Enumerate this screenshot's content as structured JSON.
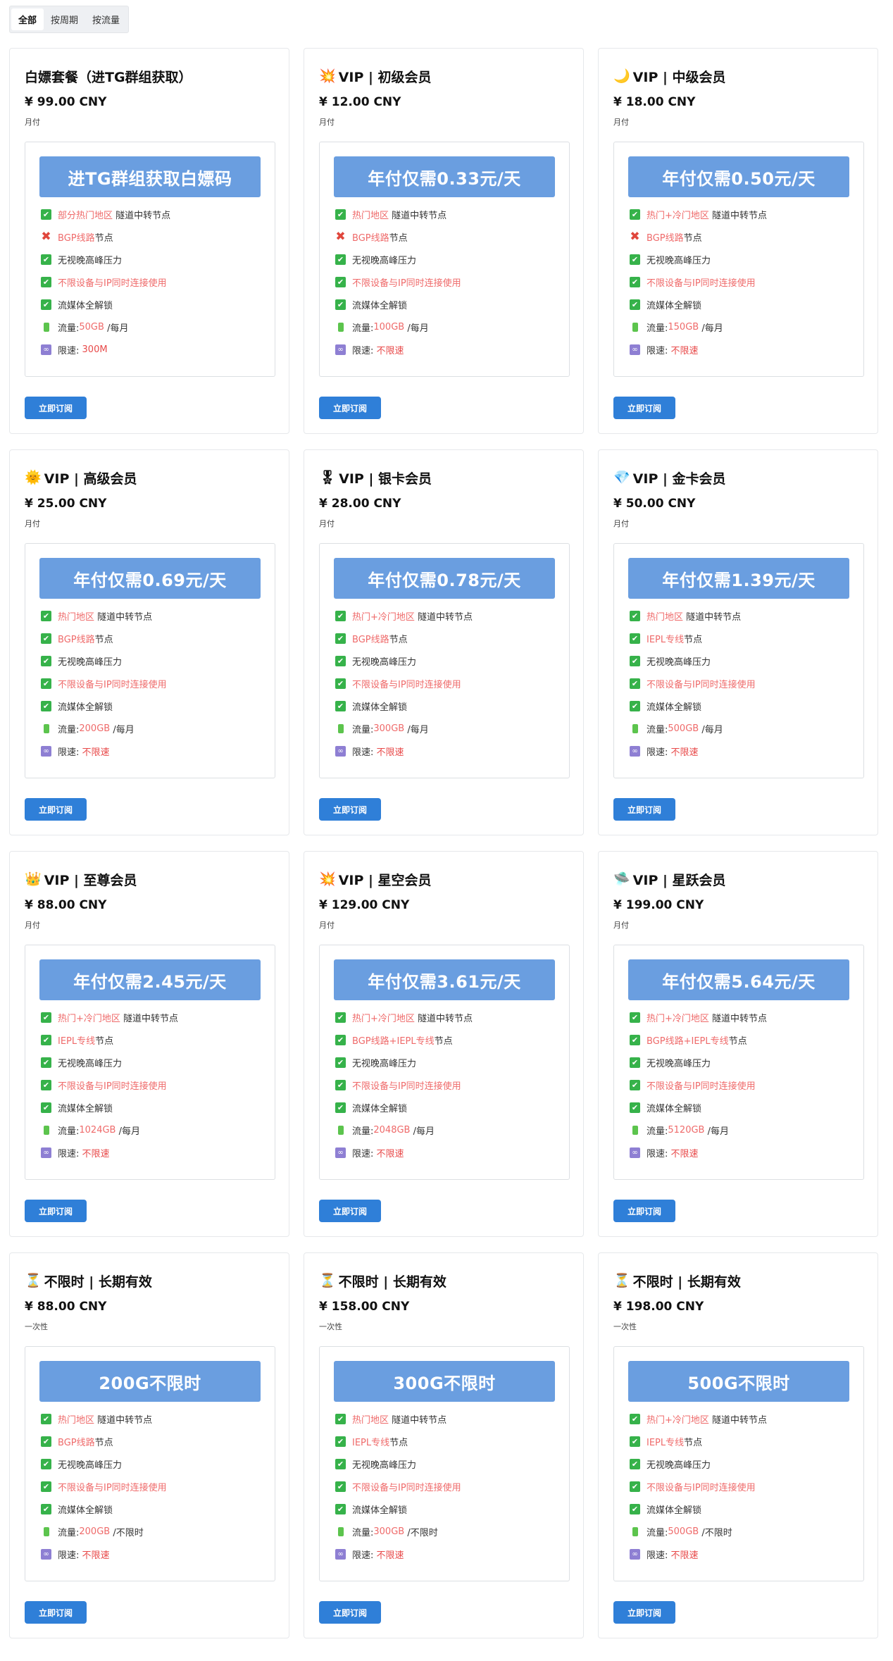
{
  "tabs": [
    {
      "label": "全部",
      "active": true
    },
    {
      "label": "按周期",
      "active": false
    },
    {
      "label": "按流量",
      "active": false
    }
  ],
  "features_common": {
    "node_suffix": "隧道中转节点",
    "node_line_suffix": "节点",
    "peak": "无视晚高峰压力",
    "devices": "不限设备与IP同时连接使用",
    "media": "流媒体全解锁",
    "traffic_label": "流量:",
    "speed_label": "限速:",
    "buy": "立即订阅"
  },
  "plans": [
    {
      "icon": "",
      "title": "白嫖套餐（进TG群组获取）",
      "price": "¥ 99.00 CNY",
      "period": "月付",
      "banner": "进TG群组获取白嫖码",
      "region": "部分热门地区",
      "line": "BGP线路",
      "line_ok": false,
      "traffic": "50GB",
      "traffic_suffix": "/每月",
      "speed": "300M"
    },
    {
      "icon": "💥",
      "title": "VIP | 初级会员",
      "price": "¥ 12.00 CNY",
      "period": "月付",
      "banner": "年付仅需0.33元/天",
      "region": "热门地区",
      "line": "BGP线路",
      "line_ok": false,
      "traffic": "100GB",
      "traffic_suffix": "/每月",
      "speed": "不限速"
    },
    {
      "icon": "🌙",
      "title": "VIP | 中级会员",
      "price": "¥ 18.00 CNY",
      "period": "月付",
      "banner": "年付仅需0.50元/天",
      "region": "热门+冷门地区",
      "line": "BGP线路",
      "line_ok": false,
      "traffic": "150GB",
      "traffic_suffix": "/每月",
      "speed": "不限速"
    },
    {
      "icon": "🌞",
      "title": "VIP | 高级会员",
      "price": "¥ 25.00 CNY",
      "period": "月付",
      "banner": "年付仅需0.69元/天",
      "region": "热门地区",
      "line": "BGP线路",
      "line_ok": true,
      "traffic": "200GB",
      "traffic_suffix": "/每月",
      "speed": "不限速"
    },
    {
      "icon": "🎖",
      "title": "VIP | 银卡会员",
      "price": "¥ 28.00 CNY",
      "period": "月付",
      "banner": "年付仅需0.78元/天",
      "region": "热门+冷门地区",
      "line": "BGP线路",
      "line_ok": true,
      "traffic": "300GB",
      "traffic_suffix": "/每月",
      "speed": "不限速"
    },
    {
      "icon": "💎",
      "title": "VIP | 金卡会员",
      "price": "¥ 50.00 CNY",
      "period": "月付",
      "banner": "年付仅需1.39元/天",
      "region": "热门地区",
      "line": "IEPL专线",
      "line_ok": true,
      "traffic": "500GB",
      "traffic_suffix": "/每月",
      "speed": "不限速"
    },
    {
      "icon": "👑",
      "title": "VIP | 至尊会员",
      "price": "¥ 88.00 CNY",
      "period": "月付",
      "banner": "年付仅需2.45元/天",
      "region": "热门+冷门地区",
      "line": "IEPL专线",
      "line_ok": true,
      "traffic": "1024GB",
      "traffic_suffix": "/每月",
      "speed": "不限速"
    },
    {
      "icon": "💥",
      "title": "VIP | 星空会员",
      "price": "¥ 129.00 CNY",
      "period": "月付",
      "banner": "年付仅需3.61元/天",
      "region": "热门+冷门地区",
      "line": "BGP线路+IEPL专线",
      "line_ok": true,
      "traffic": "2048GB",
      "traffic_suffix": "/每月",
      "speed": "不限速"
    },
    {
      "icon": "🛸",
      "title": "VIP | 星跃会员",
      "price": "¥ 199.00 CNY",
      "period": "月付",
      "banner": "年付仅需5.64元/天",
      "region": "热门+冷门地区",
      "line": "BGP线路+IEPL专线",
      "line_ok": true,
      "traffic": "5120GB",
      "traffic_suffix": "/每月",
      "speed": "不限速"
    },
    {
      "icon": "⏳",
      "title": "不限时 | 长期有效",
      "price": "¥ 88.00 CNY",
      "period": "一次性",
      "banner": "200G不限时",
      "region": "热门地区",
      "line": "BGP线路",
      "line_ok": true,
      "traffic": "200GB",
      "traffic_suffix": "/不限时",
      "speed": "不限速"
    },
    {
      "icon": "⏳",
      "title": "不限时 | 长期有效",
      "price": "¥ 158.00 CNY",
      "period": "一次性",
      "banner": "300G不限时",
      "region": "热门地区",
      "line": "IEPL专线",
      "line_ok": true,
      "traffic": "300GB",
      "traffic_suffix": "/不限时",
      "speed": "不限速"
    },
    {
      "icon": "⏳",
      "title": "不限时 | 长期有效",
      "price": "¥ 198.00 CNY",
      "period": "一次性",
      "banner": "500G不限时",
      "region": "热门+冷门地区",
      "line": "IEPL专线",
      "line_ok": true,
      "traffic": "500GB",
      "traffic_suffix": "/不限时",
      "speed": "不限速"
    }
  ]
}
